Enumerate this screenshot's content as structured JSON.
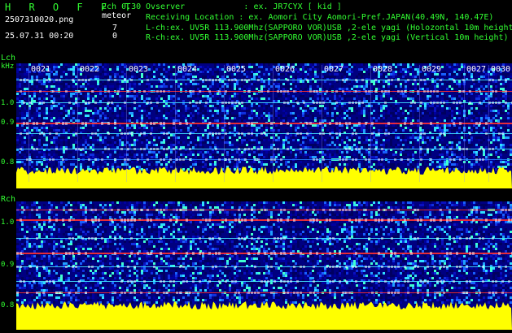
{
  "header": {
    "app_title": "H R O F F T",
    "filename": "2507310020.png",
    "datetime": "25.07.31 00:20",
    "channel_mode": "2ch 0.30",
    "meteor_label": "meteor",
    "count_l": "7",
    "count_r": "0",
    "observer_line": "Ovserver            : ex. JR7CYX [ kid ]",
    "location_line": "Receiving Location : ex. Aomori City Aomori-Pref.JAPAN(40.49N, 140.47E)",
    "lch_line": "L-ch:ex. UV5R 113.900Mhz(SAPPORO VOR)USB ,2-ele yagi (Holozontal 10m height)",
    "rch_line": "R-ch:ex. UV5R 113.900Mhz(SAPPORO VOR)USB ,2-ele yagi (Vertical 10m height)"
  },
  "panels": {
    "l_label": "Lch",
    "khz_label": "kHz",
    "r_label": "Rch",
    "time_labels": [
      "0021",
      "0022",
      "0023",
      "0024",
      "0025",
      "0026",
      "0027",
      "0028",
      "0029",
      "0027",
      "0030"
    ],
    "y_ticks_l": [
      "1.0",
      "0.9",
      "0.8"
    ],
    "y_ticks_r": [
      "1.0",
      "0.9",
      "0.8"
    ]
  },
  "colors": {
    "label_green": "#32ff32",
    "spectrum_bg": "#000080",
    "noise_bar": "#ffff00",
    "line_red": "#ff3030",
    "line_cyan": "#40e0ff"
  }
}
